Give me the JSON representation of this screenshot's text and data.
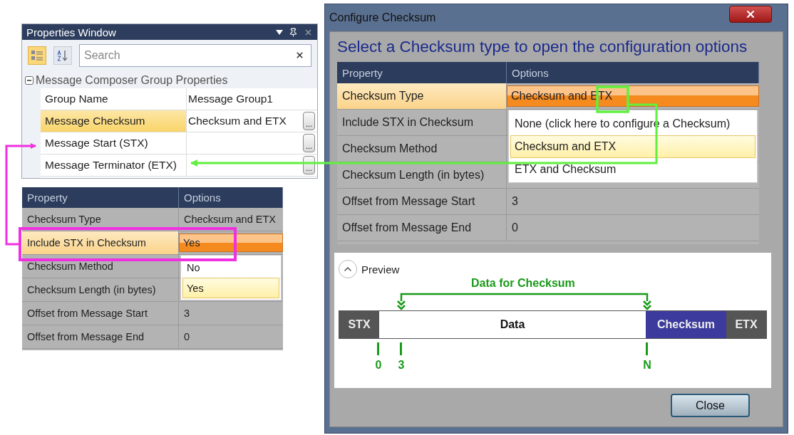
{
  "properties_window": {
    "title": "Properties Window",
    "toolbar": [
      {
        "kind": "categorized",
        "selected": true
      },
      {
        "kind": "alphabetical",
        "selected": false
      }
    ],
    "search": {
      "placeholder": "Search"
    },
    "group": {
      "label": "Message Composer Group Properties",
      "expanded": true
    },
    "rows": [
      {
        "name": "Group Name",
        "value": "Message Group1",
        "selected": false
      },
      {
        "name": "Message Checksum",
        "value": "Checksum and ETX",
        "button": "...",
        "selected": true
      },
      {
        "name": "Message Start (STX)",
        "button": "...",
        "selected": false
      },
      {
        "name": "Message Terminator (ETX)",
        "button": "...",
        "selected": false
      }
    ]
  },
  "stx_panel": {
    "columns": [
      "Property",
      "Options"
    ],
    "rows": [
      {
        "property": "Checksum Type",
        "value": "Checksum and ETX",
        "selected": false
      },
      {
        "property": "Include STX in Checksum",
        "value": "Yes",
        "selected": true
      },
      {
        "property": "Checksum Method",
        "selected": false
      },
      {
        "property": "Checksum Length (in bytes)",
        "selected": false
      },
      {
        "property": "Offset from Message Start",
        "value": "3",
        "selected": false
      },
      {
        "property": "Offset from Message End",
        "value": "0",
        "selected": false
      }
    ],
    "dropdown": {
      "options": [
        {
          "label": "No",
          "selected": false
        },
        {
          "label": "Yes",
          "selected": true
        }
      ]
    }
  },
  "dialog": {
    "title": "Configure Checksum",
    "heading": "Select a Checksum type to open the configuration options",
    "columns": [
      "Property",
      "Options"
    ],
    "rows": [
      {
        "property": "Checksum Type",
        "value": "Checksum and ETX",
        "selected": true
      },
      {
        "property": "Include STX in Checksum",
        "selected": false
      },
      {
        "property": "Checksum Method",
        "selected": false
      },
      {
        "property": "Checksum Length (in bytes)",
        "selected": false
      },
      {
        "property": "Offset from Message Start",
        "value": "3",
        "selected": false
      },
      {
        "property": "Offset from Message End",
        "value": "0",
        "selected": false
      }
    ],
    "dropdown": {
      "options": [
        {
          "label": "None (click here to configure a Checksum)",
          "selected": false
        },
        {
          "label": "Checksum and ETX",
          "selected": true
        },
        {
          "label": "ETX and Checksum",
          "selected": false
        }
      ]
    },
    "preview": {
      "label": "Preview",
      "expanded": true,
      "bracket_label": "Data for Checksum",
      "segments": [
        {
          "label": "STX",
          "kind": "marker"
        },
        {
          "label": "Data",
          "kind": "data"
        },
        {
          "label": "Checksum",
          "kind": "checksum"
        },
        {
          "label": "ETX",
          "kind": "marker"
        }
      ],
      "ticks": [
        "0",
        "3",
        "N"
      ]
    },
    "buttons": [
      "Close"
    ]
  }
}
